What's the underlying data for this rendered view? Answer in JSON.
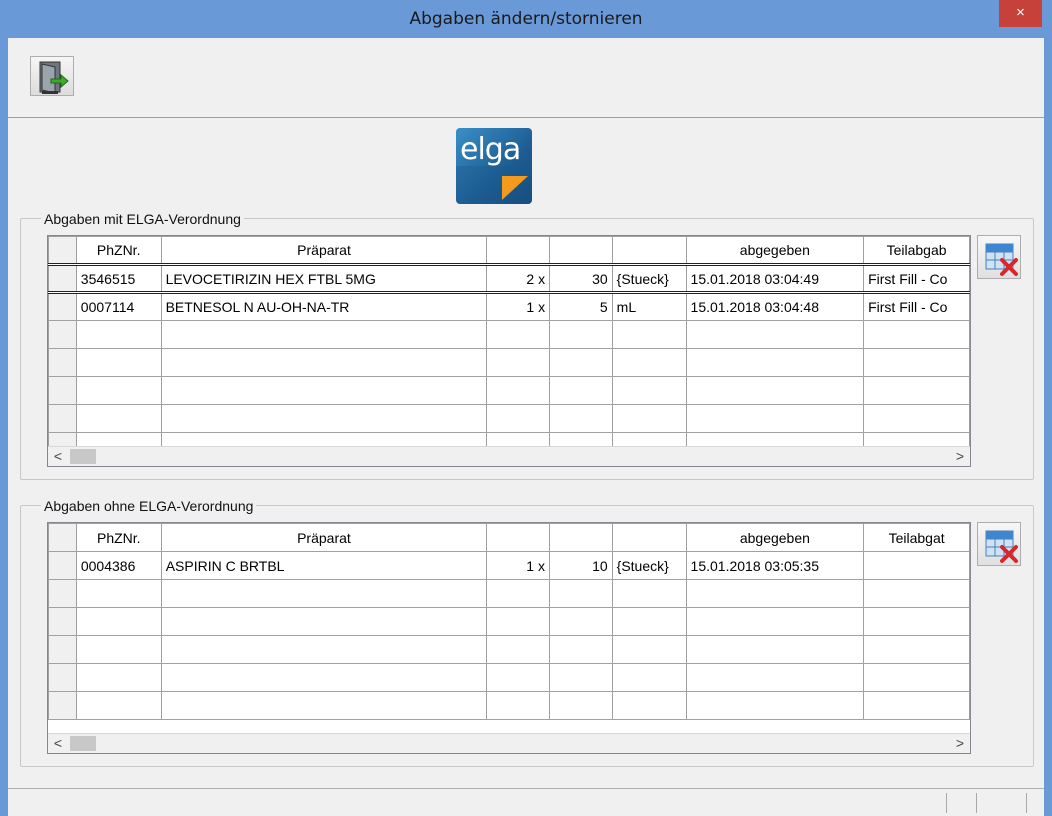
{
  "window": {
    "title": "Abgaben ändern/stornieren",
    "close_label": "×"
  },
  "toolbar": {
    "exit_icon": "exit-door-icon"
  },
  "logo": {
    "text": "elga"
  },
  "group1": {
    "label": "Abgaben mit ELGA-Verordnung",
    "columns": [
      "PhZNr.",
      "Präparat",
      "",
      "",
      "",
      "abgegeben",
      "Teilabgab"
    ],
    "rows": [
      {
        "phznr": "3546515",
        "praeparat": "LEVOCETIRIZIN HEX FTBL 5MG",
        "anzahl": "2 x",
        "menge": "30",
        "einheit": "{Stueck}",
        "abgegeben": "15.01.2018 03:04:49",
        "teilabgabe": "First Fill - Co"
      },
      {
        "phznr": "0007114",
        "praeparat": "BETNESOL N AU-OH-NA-TR",
        "anzahl": "1 x",
        "menge": "5",
        "einheit": "mL",
        "abgegeben": "15.01.2018 03:04:48",
        "teilabgabe": "First Fill - Co"
      }
    ]
  },
  "group2": {
    "label": "Abgaben ohne ELGA-Verordnung",
    "columns": [
      "PhZNr.",
      "Präparat",
      "",
      "",
      "",
      "abgegeben",
      "Teilabgat"
    ],
    "rows": [
      {
        "phznr": "0004386",
        "praeparat": "ASPIRIN C BRTBL",
        "anzahl": "1 x",
        "menge": "10",
        "einheit": "{Stueck}",
        "abgegeben": "15.01.2018 03:05:35",
        "teilabgabe": ""
      }
    ]
  },
  "scroll": {
    "left": "<",
    "right": ">"
  }
}
